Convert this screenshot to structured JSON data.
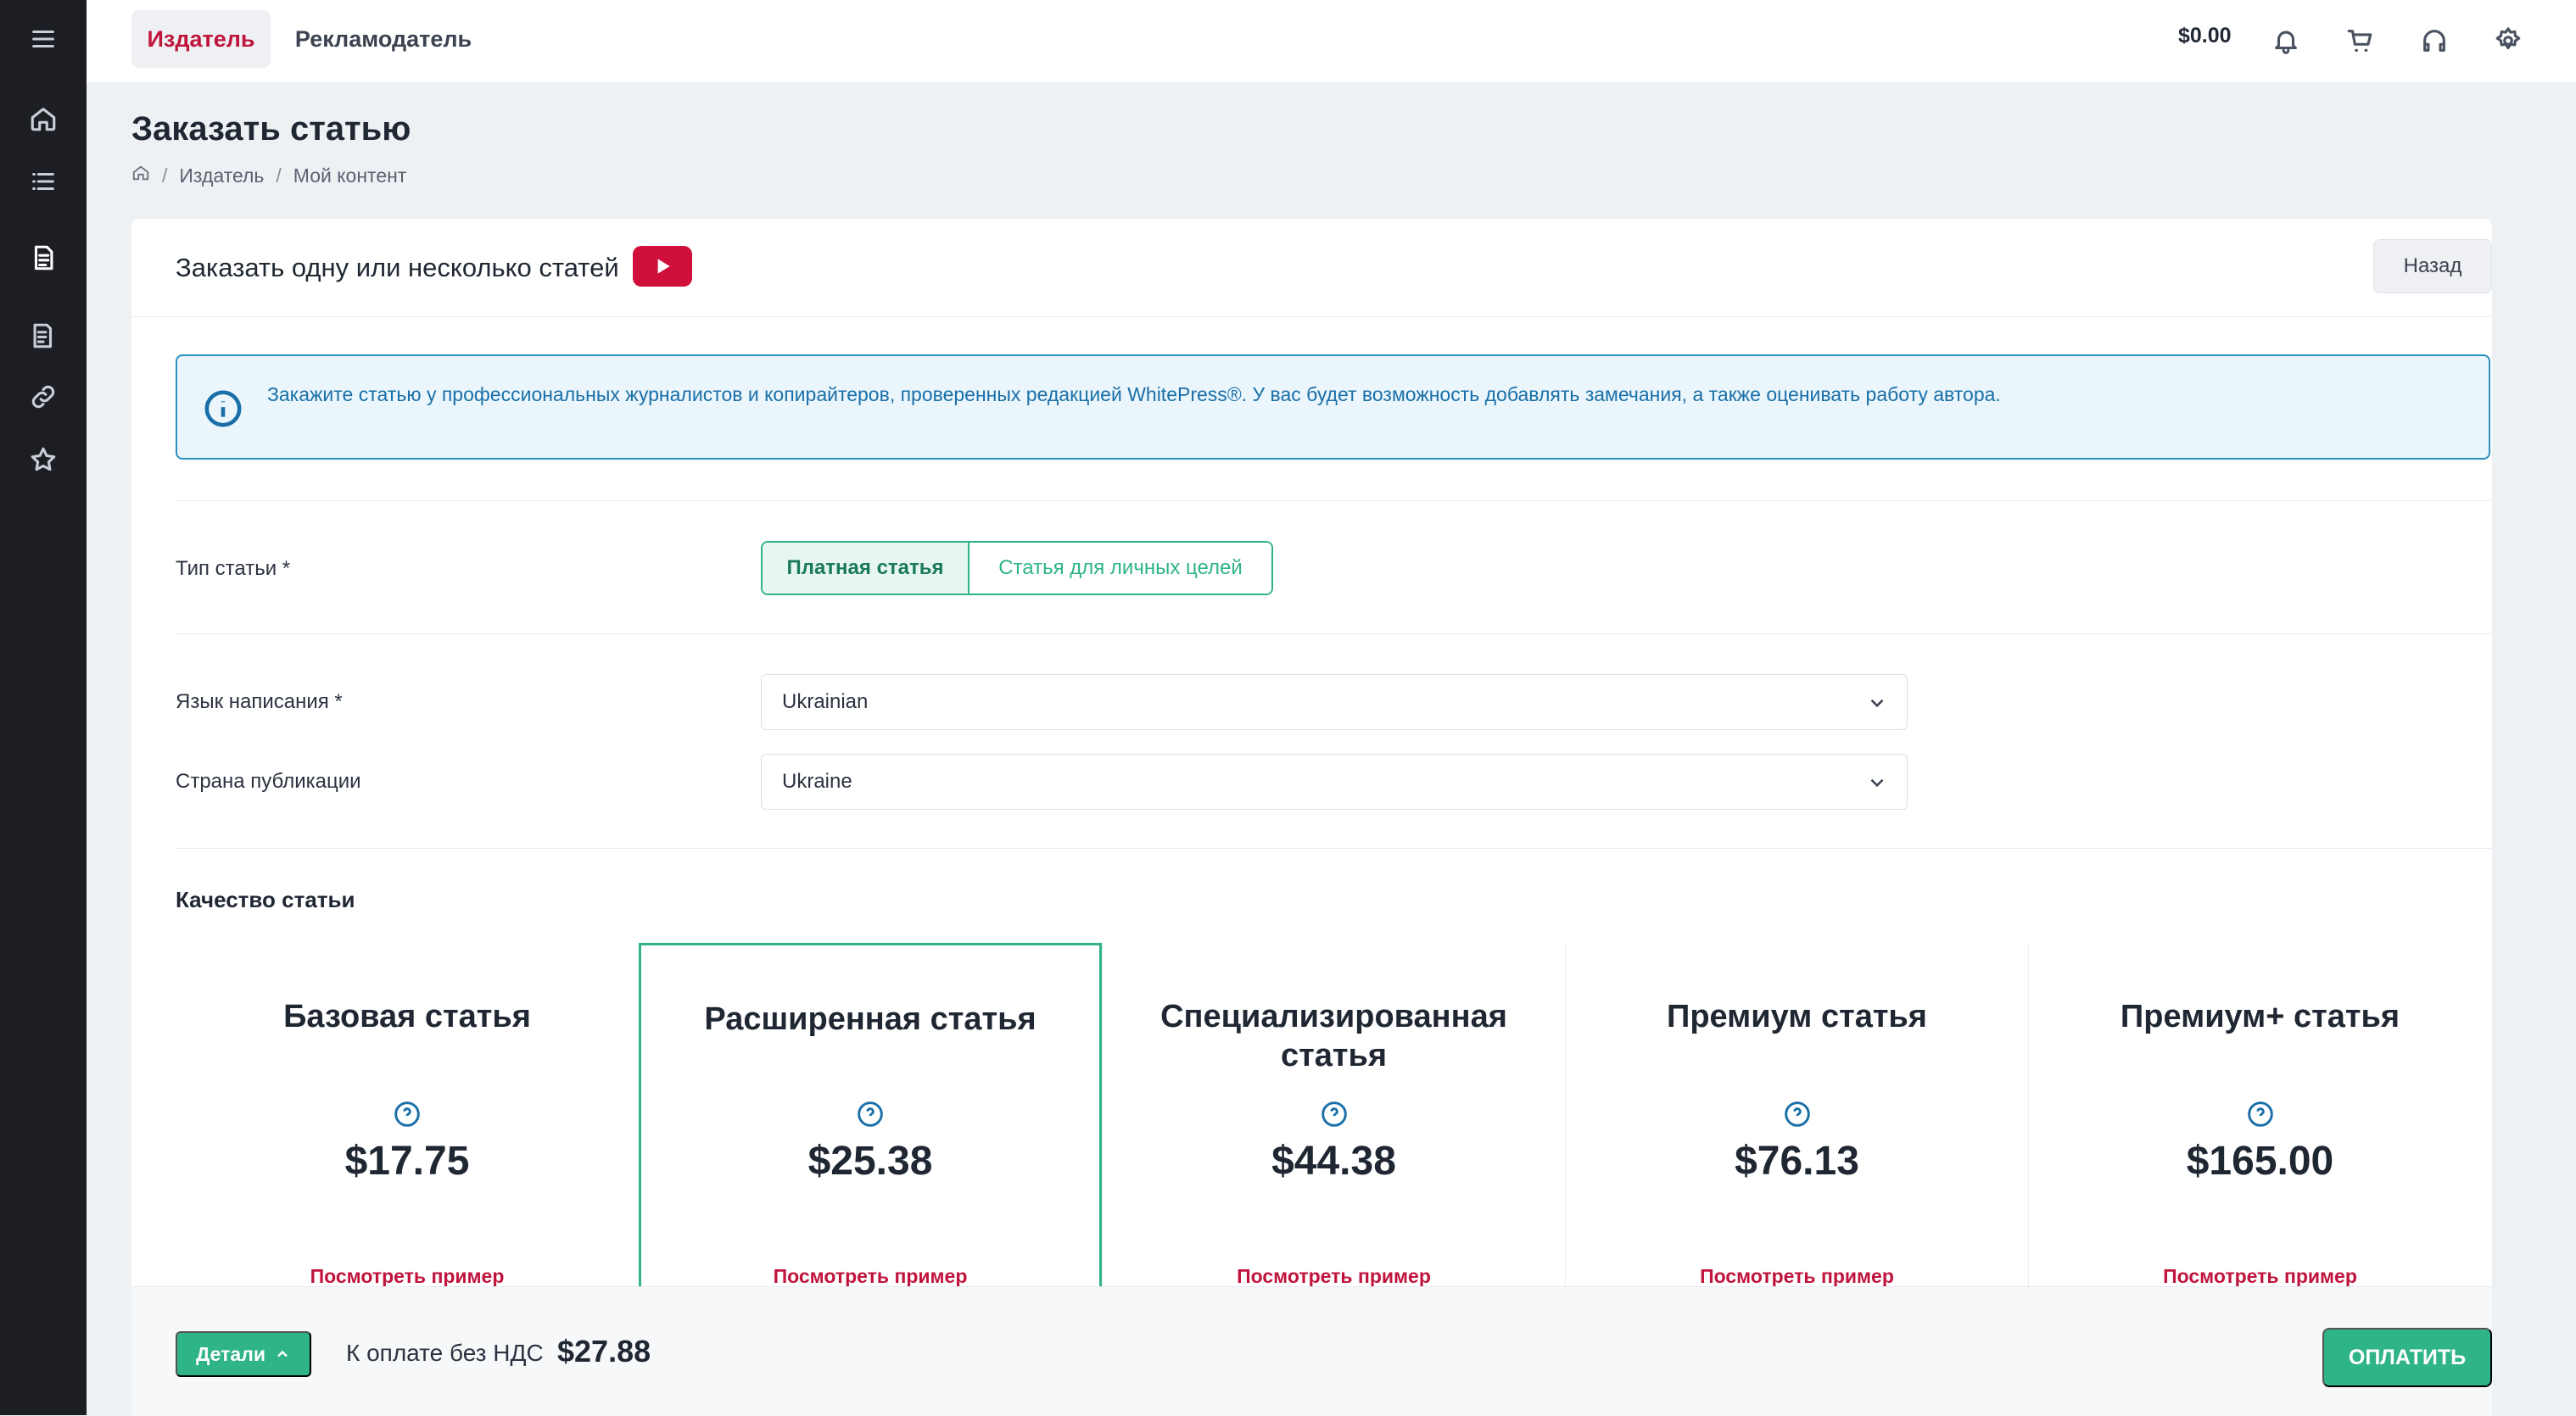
{
  "topbar": {
    "tabs": [
      {
        "label": "Издатель",
        "active": true
      },
      {
        "label": "Рекламодатель",
        "active": false
      }
    ],
    "balance": "$0.00",
    "icons": [
      "bell-icon",
      "cart-icon",
      "headphones-icon",
      "gear-icon"
    ]
  },
  "sidebar": {
    "icons": [
      "menu-icon",
      "home-icon",
      "list-icon",
      "document-icon",
      "invoice-icon",
      "link-icon",
      "star-icon"
    ],
    "active": "document-icon"
  },
  "page": {
    "title": "Заказать статью",
    "breadcrumb": [
      "Издатель",
      "Мой контент"
    ]
  },
  "card": {
    "title": "Заказать одну или несколько статей",
    "back_label": "Назад",
    "info_text": "Закажите статью у профессиональных журналистов и копирайтеров, проверенных редакцией WhitePress®. У вас будет возможность добавлять замечания, а также оценивать работу автора."
  },
  "form": {
    "type_label": "Тип статьи *",
    "type_options": [
      {
        "label": "Платная статья",
        "selected": true
      },
      {
        "label": "Статья для личных целей",
        "selected": false
      }
    ],
    "language_label": "Язык написания *",
    "language_value": "Ukrainian",
    "country_label": "Страна публикации",
    "country_value": "Ukraine"
  },
  "quality": {
    "title": "Качество статьи",
    "tiers": [
      {
        "name": "Базовая статья",
        "price": "$17.75",
        "link": "Посмотреть пример",
        "selected": false
      },
      {
        "name": "Расширенная статья",
        "price": "$25.38",
        "link": "Посмотреть пример",
        "selected": true
      },
      {
        "name": "Специализированная статья",
        "price": "$44.38",
        "link": "Посмотреть пример",
        "selected": false
      },
      {
        "name": "Премиум статья",
        "price": "$76.13",
        "link": "Посмотреть пример",
        "selected": false
      },
      {
        "name": "Премиум+ статья",
        "price": "$165.00",
        "link": "Посмотреть пример",
        "selected": false
      }
    ]
  },
  "footer": {
    "details_label": "Детали",
    "pay_label": "К оплате без НДС",
    "pay_amount": "$27.88",
    "pay_button": "ОПЛАТИТЬ"
  },
  "colors": {
    "accent_green": "#2fb489",
    "brand_red": "#c0143c",
    "info_blue": "#1a6fa8",
    "sidebar_bg": "#1c1e24"
  }
}
